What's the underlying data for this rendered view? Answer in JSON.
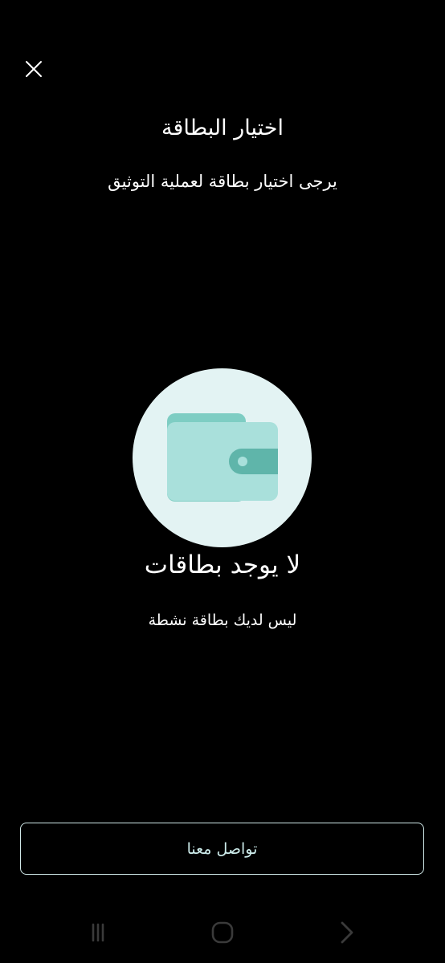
{
  "header": {
    "close_icon": "close-icon",
    "title": "اختيار البطاقة",
    "subtitle": "يرجى اختيار بطاقة لعملية التوثيق"
  },
  "empty_state": {
    "icon": "wallet-icon",
    "title": "لا يوجد بطاقات",
    "description": "ليس لديك بطاقة نشطة"
  },
  "actions": {
    "contact_label": "تواصل معنا"
  },
  "system_nav": {
    "recents_icon": "recents-icon",
    "home_icon": "home-icon",
    "back_icon": "back-icon"
  },
  "colors": {
    "background": "#000000",
    "circle": "#e3f3f3",
    "wallet_back": "#7ecdc3",
    "wallet_front": "#a9e0db",
    "wallet_clasp": "#5fb5aa",
    "button_text": "#cdeceb",
    "nav_icons": "#3a3a3a"
  }
}
